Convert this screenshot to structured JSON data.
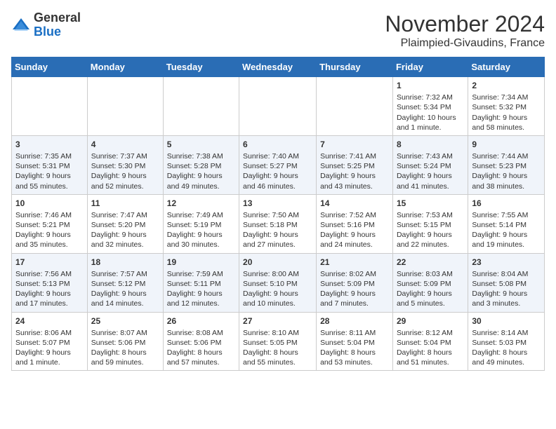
{
  "header": {
    "logo_general": "General",
    "logo_blue": "Blue",
    "month": "November 2024",
    "location": "Plaimpied-Givaudins, France"
  },
  "days_of_week": [
    "Sunday",
    "Monday",
    "Tuesday",
    "Wednesday",
    "Thursday",
    "Friday",
    "Saturday"
  ],
  "weeks": [
    [
      {
        "day": "",
        "info": ""
      },
      {
        "day": "",
        "info": ""
      },
      {
        "day": "",
        "info": ""
      },
      {
        "day": "",
        "info": ""
      },
      {
        "day": "",
        "info": ""
      },
      {
        "day": "1",
        "info": "Sunrise: 7:32 AM\nSunset: 5:34 PM\nDaylight: 10 hours and 1 minute."
      },
      {
        "day": "2",
        "info": "Sunrise: 7:34 AM\nSunset: 5:32 PM\nDaylight: 9 hours and 58 minutes."
      }
    ],
    [
      {
        "day": "3",
        "info": "Sunrise: 7:35 AM\nSunset: 5:31 PM\nDaylight: 9 hours and 55 minutes."
      },
      {
        "day": "4",
        "info": "Sunrise: 7:37 AM\nSunset: 5:30 PM\nDaylight: 9 hours and 52 minutes."
      },
      {
        "day": "5",
        "info": "Sunrise: 7:38 AM\nSunset: 5:28 PM\nDaylight: 9 hours and 49 minutes."
      },
      {
        "day": "6",
        "info": "Sunrise: 7:40 AM\nSunset: 5:27 PM\nDaylight: 9 hours and 46 minutes."
      },
      {
        "day": "7",
        "info": "Sunrise: 7:41 AM\nSunset: 5:25 PM\nDaylight: 9 hours and 43 minutes."
      },
      {
        "day": "8",
        "info": "Sunrise: 7:43 AM\nSunset: 5:24 PM\nDaylight: 9 hours and 41 minutes."
      },
      {
        "day": "9",
        "info": "Sunrise: 7:44 AM\nSunset: 5:23 PM\nDaylight: 9 hours and 38 minutes."
      }
    ],
    [
      {
        "day": "10",
        "info": "Sunrise: 7:46 AM\nSunset: 5:21 PM\nDaylight: 9 hours and 35 minutes."
      },
      {
        "day": "11",
        "info": "Sunrise: 7:47 AM\nSunset: 5:20 PM\nDaylight: 9 hours and 32 minutes."
      },
      {
        "day": "12",
        "info": "Sunrise: 7:49 AM\nSunset: 5:19 PM\nDaylight: 9 hours and 30 minutes."
      },
      {
        "day": "13",
        "info": "Sunrise: 7:50 AM\nSunset: 5:18 PM\nDaylight: 9 hours and 27 minutes."
      },
      {
        "day": "14",
        "info": "Sunrise: 7:52 AM\nSunset: 5:16 PM\nDaylight: 9 hours and 24 minutes."
      },
      {
        "day": "15",
        "info": "Sunrise: 7:53 AM\nSunset: 5:15 PM\nDaylight: 9 hours and 22 minutes."
      },
      {
        "day": "16",
        "info": "Sunrise: 7:55 AM\nSunset: 5:14 PM\nDaylight: 9 hours and 19 minutes."
      }
    ],
    [
      {
        "day": "17",
        "info": "Sunrise: 7:56 AM\nSunset: 5:13 PM\nDaylight: 9 hours and 17 minutes."
      },
      {
        "day": "18",
        "info": "Sunrise: 7:57 AM\nSunset: 5:12 PM\nDaylight: 9 hours and 14 minutes."
      },
      {
        "day": "19",
        "info": "Sunrise: 7:59 AM\nSunset: 5:11 PM\nDaylight: 9 hours and 12 minutes."
      },
      {
        "day": "20",
        "info": "Sunrise: 8:00 AM\nSunset: 5:10 PM\nDaylight: 9 hours and 10 minutes."
      },
      {
        "day": "21",
        "info": "Sunrise: 8:02 AM\nSunset: 5:09 PM\nDaylight: 9 hours and 7 minutes."
      },
      {
        "day": "22",
        "info": "Sunrise: 8:03 AM\nSunset: 5:09 PM\nDaylight: 9 hours and 5 minutes."
      },
      {
        "day": "23",
        "info": "Sunrise: 8:04 AM\nSunset: 5:08 PM\nDaylight: 9 hours and 3 minutes."
      }
    ],
    [
      {
        "day": "24",
        "info": "Sunrise: 8:06 AM\nSunset: 5:07 PM\nDaylight: 9 hours and 1 minute."
      },
      {
        "day": "25",
        "info": "Sunrise: 8:07 AM\nSunset: 5:06 PM\nDaylight: 8 hours and 59 minutes."
      },
      {
        "day": "26",
        "info": "Sunrise: 8:08 AM\nSunset: 5:06 PM\nDaylight: 8 hours and 57 minutes."
      },
      {
        "day": "27",
        "info": "Sunrise: 8:10 AM\nSunset: 5:05 PM\nDaylight: 8 hours and 55 minutes."
      },
      {
        "day": "28",
        "info": "Sunrise: 8:11 AM\nSunset: 5:04 PM\nDaylight: 8 hours and 53 minutes."
      },
      {
        "day": "29",
        "info": "Sunrise: 8:12 AM\nSunset: 5:04 PM\nDaylight: 8 hours and 51 minutes."
      },
      {
        "day": "30",
        "info": "Sunrise: 8:14 AM\nSunset: 5:03 PM\nDaylight: 8 hours and 49 minutes."
      }
    ]
  ]
}
